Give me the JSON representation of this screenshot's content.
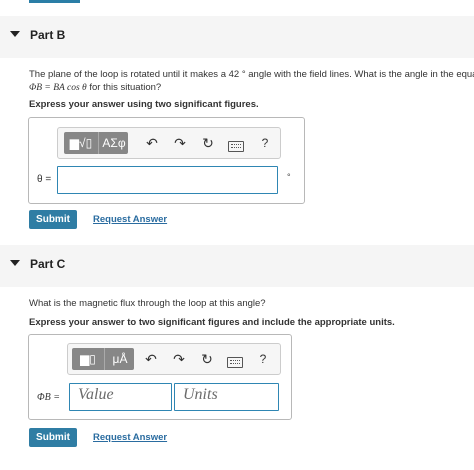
{
  "part_b": {
    "title": "Part B",
    "question_line1": "The plane of the loop is rotated until it makes a 42 ° angle with the field lines. What is the angle in the equa",
    "question_line2_suffix": "for this situation?",
    "equation": "ΦB = BA cos θ",
    "instruction": "Express your answer using two significant figures.",
    "toolbar": {
      "templates_label": "▆√▯",
      "symbols_label": "ΑΣφ",
      "undo": "↶",
      "redo": "↷",
      "reset": "↻",
      "keyboard": "keyboard-icon",
      "help": "?"
    },
    "answer_label": "θ =",
    "answer_value": "",
    "unit_symbol": "°",
    "submit_label": "Submit",
    "request_label": "Request Answer"
  },
  "part_c": {
    "title": "Part C",
    "question": "What is the magnetic flux through the loop at this angle?",
    "instruction": "Express your answer to two significant figures and include the appropriate units.",
    "toolbar": {
      "templates_label": "▆▯",
      "units_label": "μÅ",
      "undo": "↶",
      "redo": "↷",
      "reset": "↻",
      "keyboard": "keyboard-icon",
      "help": "?"
    },
    "answer_label": "ΦB =",
    "value_placeholder": "Value",
    "units_placeholder": "Units",
    "submit_label": "Submit",
    "request_label": "Request Answer"
  }
}
